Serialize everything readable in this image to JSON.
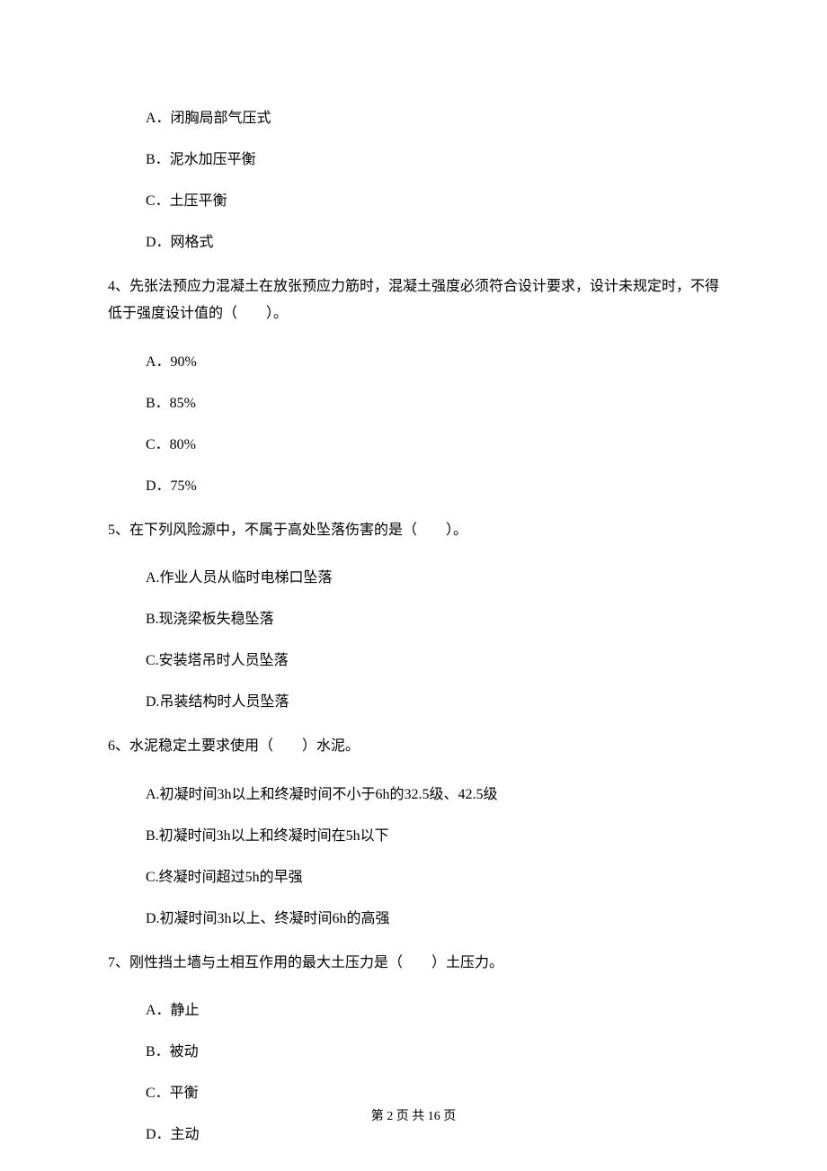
{
  "q3": {
    "options": {
      "a": "A．闭胸局部气压式",
      "b": "B．泥水加压平衡",
      "c": "C．土压平衡",
      "d": "D．网格式"
    }
  },
  "q4": {
    "text": "4、先张法预应力混凝土在放张预应力筋时，混凝土强度必须符合设计要求，设计未规定时，不得低于强度设计值的（　　）。",
    "options": {
      "a": "A．90%",
      "b": "B．85%",
      "c": "C．80%",
      "d": "D．75%"
    }
  },
  "q5": {
    "text": "5、在下列风险源中，不属于高处坠落伤害的是（　　）。",
    "options": {
      "a": "A.作业人员从临时电梯口坠落",
      "b": "B.现浇梁板失稳坠落",
      "c": "C.安装塔吊时人员坠落",
      "d": "D.吊装结构时人员坠落"
    }
  },
  "q6": {
    "text": "6、水泥稳定土要求使用（　　）水泥。",
    "options": {
      "a": "A.初凝时间3h以上和终凝时间不小于6h的32.5级、42.5级",
      "b": "B.初凝时间3h以上和终凝时间在5h以下",
      "c": "C.终凝时间超过5h的早强",
      "d": "D.初凝时间3h以上、终凝时间6h的高强"
    }
  },
  "q7": {
    "text": "7、刚性挡土墙与土相互作用的最大土压力是（　　）土压力。",
    "options": {
      "a": "A．静止",
      "b": "B．被动",
      "c": "C．平衡",
      "d": "D．主动"
    }
  },
  "footer": "第 2 页 共 16 页"
}
